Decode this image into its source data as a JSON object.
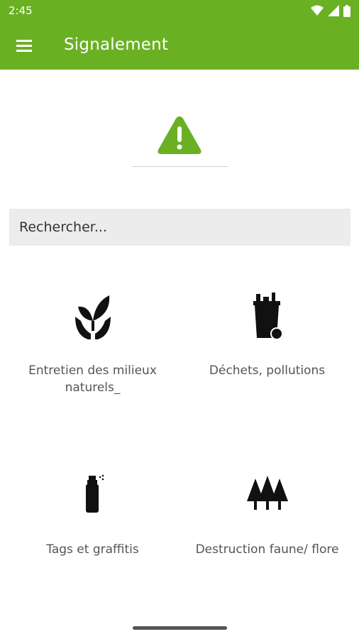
{
  "status": {
    "time": "2:45",
    "icons": [
      "wifi-icon",
      "signal-icon",
      "battery-icon"
    ]
  },
  "appbar": {
    "title": "Signalement",
    "menu_icon": "menu-icon"
  },
  "alert": {
    "icon": "warning-icon"
  },
  "search": {
    "placeholder": "Rechercher..."
  },
  "categories": [
    {
      "label": "Entretien des milieux naturels_",
      "icon": "plant-hands-icon"
    },
    {
      "label": "Déchets, pollutions",
      "icon": "trash-bin-icon"
    },
    {
      "label": "Tags et graffitis",
      "icon": "spray-can-icon"
    },
    {
      "label": "Destruction faune/ flore",
      "icon": "trees-icon"
    }
  ],
  "colors": {
    "primary": "#6ab023",
    "search_bg": "#ececec"
  }
}
